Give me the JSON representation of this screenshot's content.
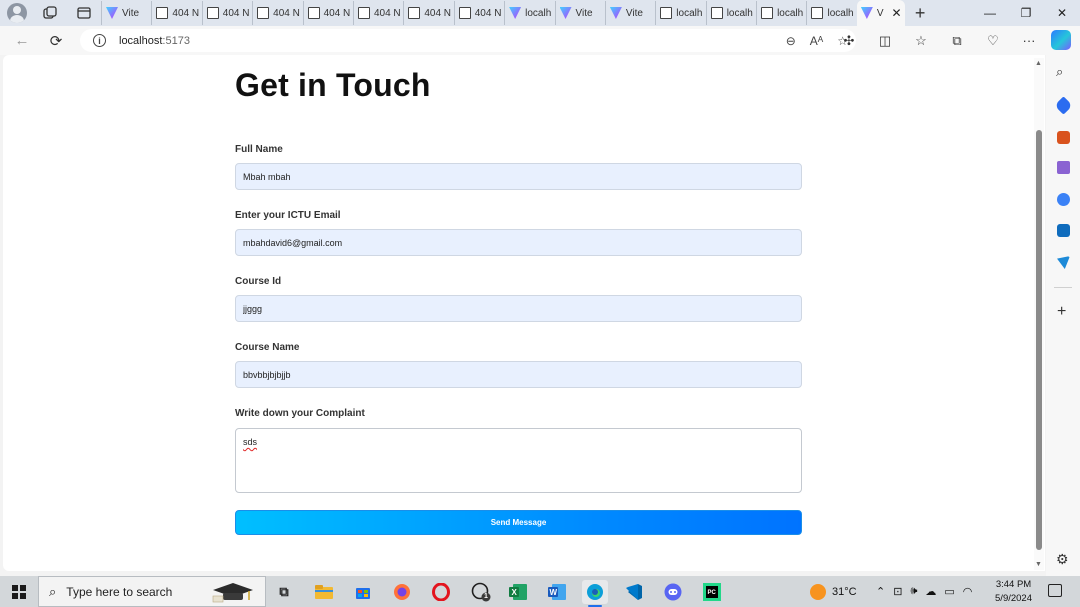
{
  "browser": {
    "tabs": [
      {
        "label": "Vite",
        "icon": "vite-icon"
      },
      {
        "label": "404 N",
        "icon": "page-icon"
      },
      {
        "label": "404 N",
        "icon": "page-icon"
      },
      {
        "label": "404 N",
        "icon": "page-icon"
      },
      {
        "label": "404 N",
        "icon": "page-icon"
      },
      {
        "label": "404 N",
        "icon": "page-icon"
      },
      {
        "label": "404 N",
        "icon": "page-icon"
      },
      {
        "label": "404 N",
        "icon": "page-icon"
      },
      {
        "label": "localh",
        "icon": "vite-icon"
      },
      {
        "label": "Vite",
        "icon": "vite-icon"
      },
      {
        "label": "Vite",
        "icon": "vite-icon"
      },
      {
        "label": "localh",
        "icon": "page-icon"
      },
      {
        "label": "localh",
        "icon": "page-icon"
      },
      {
        "label": "localh",
        "icon": "page-icon"
      },
      {
        "label": "localh",
        "icon": "page-icon"
      }
    ],
    "active_tab": {
      "label": "V",
      "icon": "vite-icon"
    },
    "url": {
      "host": "localhost",
      "port": ":5173"
    }
  },
  "page": {
    "title": "Get in Touch",
    "fields": {
      "full_name": {
        "label": "Full Name",
        "value": "Mbah mbah"
      },
      "email": {
        "label": "Enter your ICTU Email",
        "value": "mbahdavid6@gmail.com"
      },
      "course_id": {
        "label": "Course Id",
        "value": "jjggg"
      },
      "course_name": {
        "label": "Course Name",
        "value": "bbvbbjbjbjjb"
      },
      "complaint": {
        "label": "Write down your Complaint",
        "value": "sds"
      }
    },
    "submit_label": "Send Message"
  },
  "taskbar": {
    "search_placeholder": "Type here to search",
    "weather": "31°C",
    "time": "3:44 PM",
    "date": "5/9/2024",
    "whatsapp_badge": "1"
  },
  "colors": {
    "input_bg": "#e8f0fe",
    "button_gradient_start": "#00bfff",
    "button_gradient_end": "#0073ff"
  }
}
